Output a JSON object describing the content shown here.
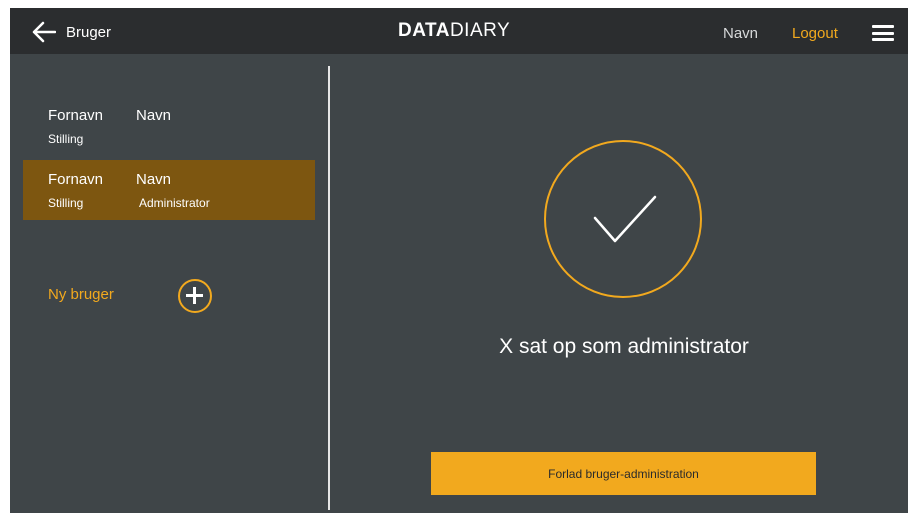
{
  "header": {
    "back_label": "Bruger",
    "logo_bold": "DATA",
    "logo_thin": "DIARY",
    "user_name": "Navn",
    "logout_label": "Logout"
  },
  "users": [
    {
      "first_name": "Fornavn",
      "last_name": "Navn",
      "position": "Stilling",
      "role": "",
      "selected": false
    },
    {
      "first_name": "Fornavn",
      "last_name": "Navn",
      "position": "Stilling",
      "role": "Administrator",
      "selected": true
    }
  ],
  "new_user_label": "Ny bruger",
  "status_message": "X  sat op som administrator",
  "leave_button_label": "Forlad bruger-administration",
  "colors": {
    "accent": "#f2a91e",
    "selected_row": "#7d5610",
    "background": "#3f4548",
    "topbar": "#2b2d2f"
  },
  "icons": [
    "back-arrow-icon",
    "hamburger-menu-icon",
    "plus-circle-icon",
    "checkmark-icon"
  ]
}
